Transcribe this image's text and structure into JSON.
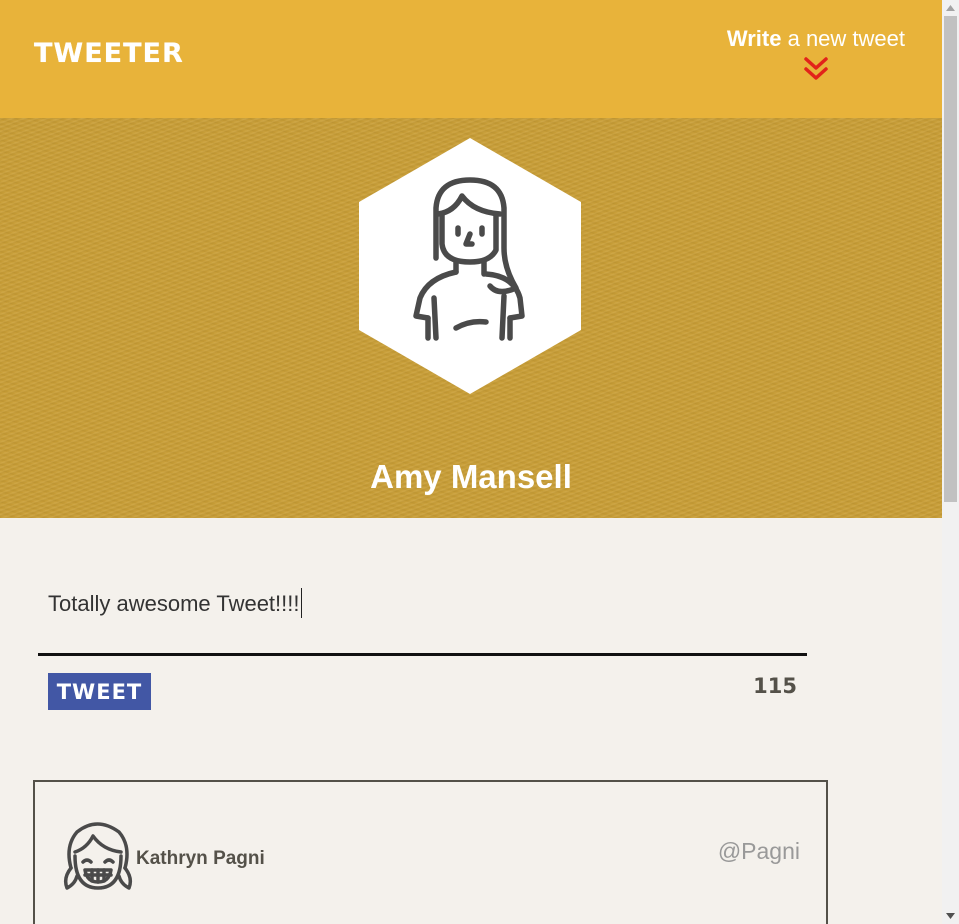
{
  "nav": {
    "logo": "TWEETER",
    "compose_bold": "Write",
    "compose_rest": " a new tweet",
    "compose_icon": "double-chevron-down-icon"
  },
  "profile": {
    "name": "Amy Mansell",
    "avatar_icon": "woman-avatar-icon"
  },
  "compose_form": {
    "text": "Totally awesome Tweet!!!!",
    "button_label": "TWEET",
    "counter": "115"
  },
  "tweets": [
    {
      "author": "Kathryn Pagni",
      "handle": "@Pagni",
      "avatar_icon": "smiling-girl-avatar-icon"
    }
  ],
  "colors": {
    "nav_bg": "#e8b33a",
    "profile_bg": "#c99e36",
    "button_bg": "#4257a5",
    "chevron": "#e2231a",
    "page_bg": "#f4f1ec"
  }
}
